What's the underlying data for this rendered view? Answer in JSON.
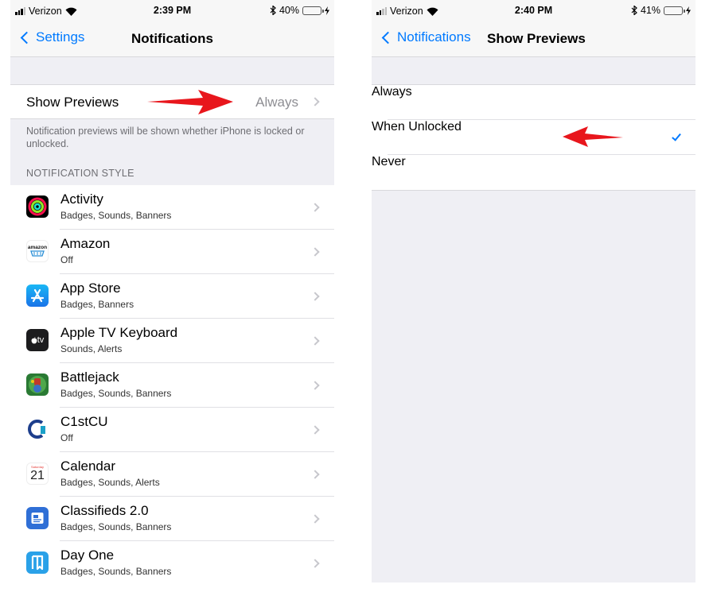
{
  "left": {
    "status": {
      "carrier": "Verizon",
      "time": "2:39 PM",
      "battery": "40%",
      "battery_level": 0.4
    },
    "nav": {
      "back_label": "Settings",
      "title": "Notifications"
    },
    "show_previews": {
      "label": "Show Previews",
      "value": "Always"
    },
    "footnote": "Notification previews will be shown whether iPhone is locked or unlocked.",
    "section_header": "NOTIFICATION STYLE",
    "apps": [
      {
        "name": "Activity",
        "detail": "Badges, Sounds, Banners",
        "icon": "activity-icon"
      },
      {
        "name": "Amazon",
        "detail": "Off",
        "icon": "amazon-icon",
        "icon_text": "amazon"
      },
      {
        "name": "App Store",
        "detail": "Badges, Banners",
        "icon": "app-store-icon"
      },
      {
        "name": "Apple TV Keyboard",
        "detail": "Sounds, Alerts",
        "icon": "apple-tv-icon",
        "icon_text": "tv"
      },
      {
        "name": "Battlejack",
        "detail": "Badges, Sounds, Banners",
        "icon": "battlejack-icon"
      },
      {
        "name": "C1stCU",
        "detail": "Off",
        "icon": "c1stcu-icon"
      },
      {
        "name": "Calendar",
        "detail": "Badges, Sounds, Alerts",
        "icon": "calendar-icon",
        "icon_day": "Saturday",
        "icon_date": "21"
      },
      {
        "name": "Classifieds 2.0",
        "detail": "Badges, Sounds, Banners",
        "icon": "classifieds-icon"
      },
      {
        "name": "Day One",
        "detail": "Badges, Sounds, Banners",
        "icon": "day-one-icon"
      }
    ]
  },
  "right": {
    "status": {
      "carrier": "Verizon",
      "time": "2:40 PM",
      "battery": "41%",
      "battery_level": 0.41
    },
    "nav": {
      "back_label": "Notifications",
      "title": "Show Previews"
    },
    "options": [
      {
        "label": "Always",
        "selected": false
      },
      {
        "label": "When Unlocked",
        "selected": true
      },
      {
        "label": "Never",
        "selected": false
      }
    ]
  },
  "colors": {
    "accent": "#007aff",
    "arrow": "#e8161c",
    "group_bg": "#efeff4"
  }
}
